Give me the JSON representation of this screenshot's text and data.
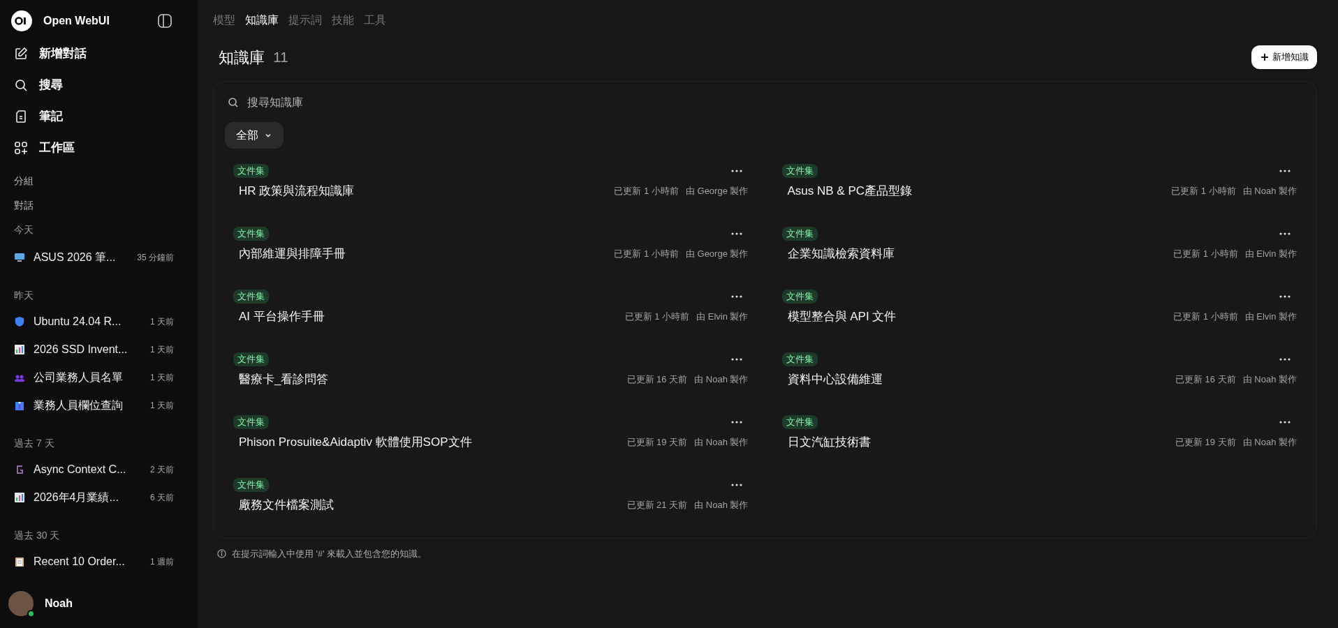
{
  "sidebar": {
    "brand": "Open WebUI",
    "nav": [
      {
        "label": "新增對話"
      },
      {
        "label": "搜尋"
      },
      {
        "label": "筆記"
      },
      {
        "label": "工作區"
      }
    ],
    "headings": [
      "分組",
      "對話"
    ],
    "groups": [
      {
        "heading": "今天",
        "chats": [
          {
            "title": "ASUS 2026 筆...",
            "time": "35 分鐘前",
            "kind": "monitor"
          }
        ]
      },
      {
        "heading": "昨天",
        "chats": [
          {
            "title": "Ubuntu 24.04 R...",
            "time": "1 天前",
            "kind": "shield"
          },
          {
            "title": "2026 SSD Invent...",
            "time": "1 天前",
            "kind": "chart"
          },
          {
            "title": "公司業務人員名單",
            "time": "1 天前",
            "kind": "people"
          },
          {
            "title": "業務人員欄位查詢",
            "time": "1 天前",
            "kind": "suit"
          }
        ]
      },
      {
        "heading": "過去 7 天",
        "chats": [
          {
            "title": "Async Context C...",
            "time": "2 天前",
            "kind": "letter"
          },
          {
            "title": "2026年4月業績...",
            "time": "6 天前",
            "kind": "chart"
          }
        ]
      },
      {
        "heading": "過去 30 天",
        "chats": [
          {
            "title": "Recent 10 Order...",
            "time": "1 週前",
            "kind": "clipboard"
          }
        ]
      }
    ],
    "user": {
      "name": "Noah",
      "online": true
    }
  },
  "tabs": [
    {
      "label": "模型",
      "selected": false
    },
    {
      "label": "知識庫",
      "selected": true
    },
    {
      "label": "提示詞",
      "selected": false
    },
    {
      "label": "技能",
      "selected": false
    },
    {
      "label": "工具",
      "selected": false
    }
  ],
  "header": {
    "title": "知識庫",
    "count": "11",
    "new_button": "新增知識"
  },
  "search": {
    "placeholder": "搜尋知識庫"
  },
  "filter": {
    "label": "全部"
  },
  "items": [
    {
      "tag": "文件集",
      "name": "HR 政策與流程知識庫",
      "updated": "已更新 1 小時前",
      "author": "由 George 製作"
    },
    {
      "tag": "文件集",
      "name": "Asus NB & PC產品型錄",
      "updated": "已更新 1 小時前",
      "author": "由 Noah 製作"
    },
    {
      "tag": "文件集",
      "name": "內部維運與排障手冊",
      "updated": "已更新 1 小時前",
      "author": "由 George 製作"
    },
    {
      "tag": "文件集",
      "name": "企業知識檢索資料庫",
      "updated": "已更新 1 小時前",
      "author": "由 Elvin 製作"
    },
    {
      "tag": "文件集",
      "name": "AI 平台操作手冊",
      "updated": "已更新 1 小時前",
      "author": "由 Elvin 製作"
    },
    {
      "tag": "文件集",
      "name": "模型整合與 API 文件",
      "updated": "已更新 1 小時前",
      "author": "由 Elvin 製作"
    },
    {
      "tag": "文件集",
      "name": "醫療卡_看診問答",
      "updated": "已更新 16 天前",
      "author": "由 Noah 製作"
    },
    {
      "tag": "文件集",
      "name": "資料中心設備維運",
      "updated": "已更新 16 天前",
      "author": "由 Noah 製作"
    },
    {
      "tag": "文件集",
      "name": "Phison Prosuite&Aidaptiv 軟體使用SOP文件",
      "updated": "已更新 19 天前",
      "author": "由 Noah 製作"
    },
    {
      "tag": "文件集",
      "name": "日文汽缸技術書",
      "updated": "已更新 19 天前",
      "author": "由 Noah 製作"
    },
    {
      "tag": "文件集",
      "name": "廠務文件檔案測試",
      "updated": "已更新 21 天前",
      "author": "由 Noah 製作"
    }
  ],
  "footer_note": "在提示詞輸入中使用 '#' 來載入並包含您的知識。"
}
